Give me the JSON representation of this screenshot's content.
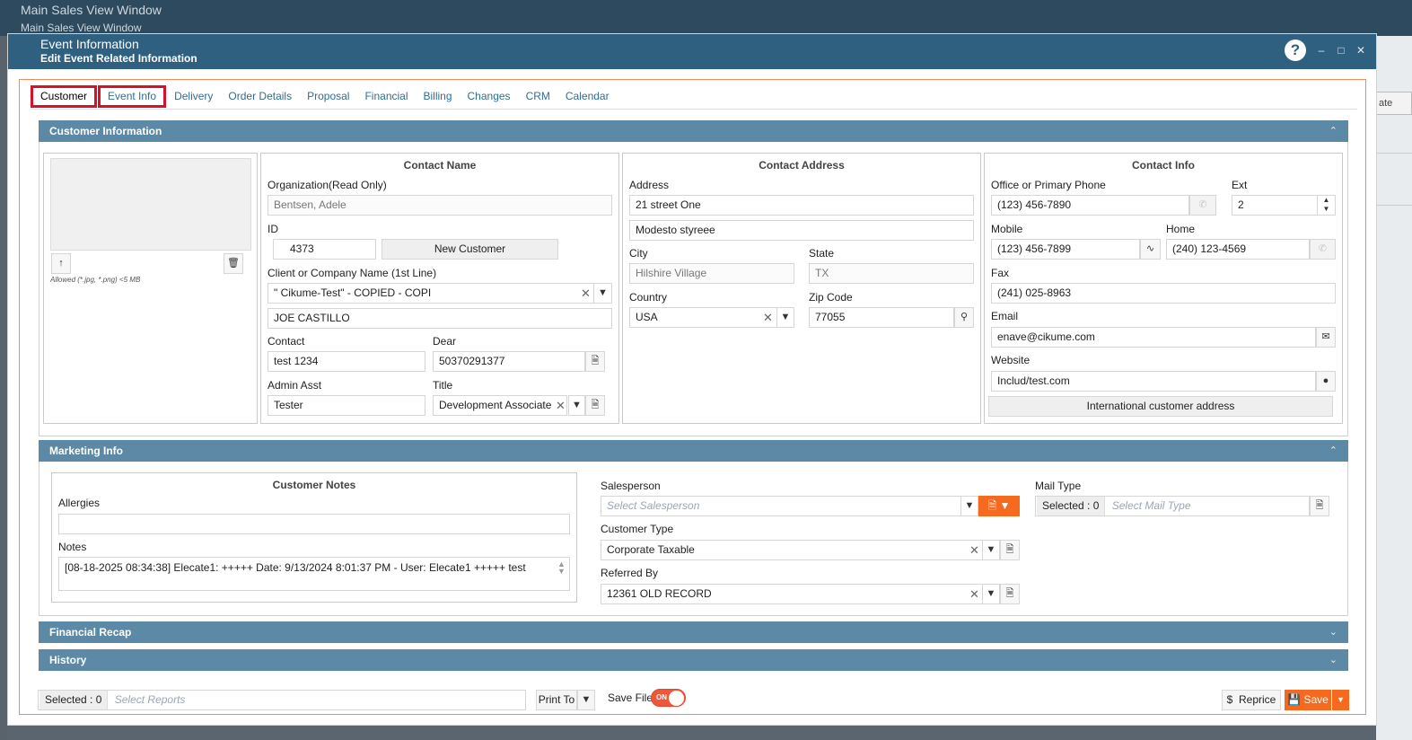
{
  "background": {
    "title": "Main Sales View Window",
    "subtitle": "Main Sales View Window",
    "cut_label": "ate"
  },
  "window": {
    "title": "Event Information",
    "subtitle": "Edit Event Related Information",
    "help": "?"
  },
  "tabs": [
    "Customer",
    "Event Info",
    "Delivery",
    "Order Details",
    "Proposal",
    "Financial",
    "Billing",
    "Changes",
    "CRM",
    "Calendar"
  ],
  "customer_info": {
    "header": "Customer Information",
    "photo": {
      "allowed": "Allowed (*.jpg, *.png) <5 MB"
    },
    "contact_name": {
      "title": "Contact Name",
      "org_label": "Organization(Read Only)",
      "org_value": "Bentsen, Adele",
      "id_label": "ID",
      "id_value": "4373",
      "new_customer": "New Customer",
      "client_label": "Client or Company Name (1st Line)",
      "client_value": "\" Cikume-Test\" - COPIED - COPI",
      "second_line": "JOE CASTILLO",
      "contact_label": "Contact",
      "contact_value": "test 1234",
      "dear_label": "Dear",
      "dear_value": "50370291377",
      "admin_label": "Admin Asst",
      "admin_value": "Tester",
      "title_label": "Title",
      "title_value": "Development Associate"
    },
    "contact_address": {
      "title": "Contact Address",
      "address_label": "Address",
      "address1": "21 street One",
      "address2": "Modesto styreee",
      "city_label": "City",
      "city_value": "Hilshire Village",
      "state_label": "State",
      "state_value": "TX",
      "country_label": "Country",
      "country_value": "USA",
      "zip_label": "Zip Code",
      "zip_value": "77055"
    },
    "contact_info": {
      "title": "Contact Info",
      "office_label": "Office or Primary Phone",
      "office_value": "(123) 456-7890",
      "ext_label": "Ext",
      "ext_value": "2",
      "mobile_label": "Mobile",
      "mobile_value": "(123) 456-7899",
      "home_label": "Home",
      "home_value": "(240) 123-4569",
      "fax_label": "Fax",
      "fax_value": "(241) 025-8963",
      "email_label": "Email",
      "email_value": "enave@cikume.com",
      "website_label": "Website",
      "website_value": "Includ/test.com",
      "intl_button": "International customer address"
    }
  },
  "marketing": {
    "header": "Marketing Info",
    "notes_box": {
      "title": "Customer Notes",
      "allergies_label": "Allergies",
      "allergies_value": "",
      "notes_label": "Notes",
      "notes_value": "[08-18-2025 08:34:38] Elecate1: +++++ Date: 9/13/2024 8:01:37 PM - User: Elecate1 +++++ test"
    },
    "salesperson_label": "Salesperson",
    "salesperson_placeholder": "Select Salesperson",
    "customer_type_label": "Customer Type",
    "customer_type_value": "Corporate Taxable",
    "referred_label": "Referred By",
    "referred_value": "12361 OLD RECORD",
    "mail_type_label": "Mail Type",
    "mail_selected": "Selected : 0",
    "mail_placeholder": "Select Mail Type"
  },
  "financial_recap": {
    "header": "Financial Recap"
  },
  "history": {
    "header": "History"
  },
  "footer": {
    "reports_selected": "Selected : 0",
    "reports_placeholder": "Select Reports",
    "print_to": "Print To",
    "save_file_label": "Save File",
    "toggle_text": "ON",
    "reprice": "Reprice",
    "reprice_symbol": "$",
    "save": "Save"
  },
  "colors": {
    "header_blue": "#2f6080",
    "panel_blue": "#5b89a6",
    "accent_orange": "#f56a1f",
    "highlight_red": "#d6122a"
  }
}
